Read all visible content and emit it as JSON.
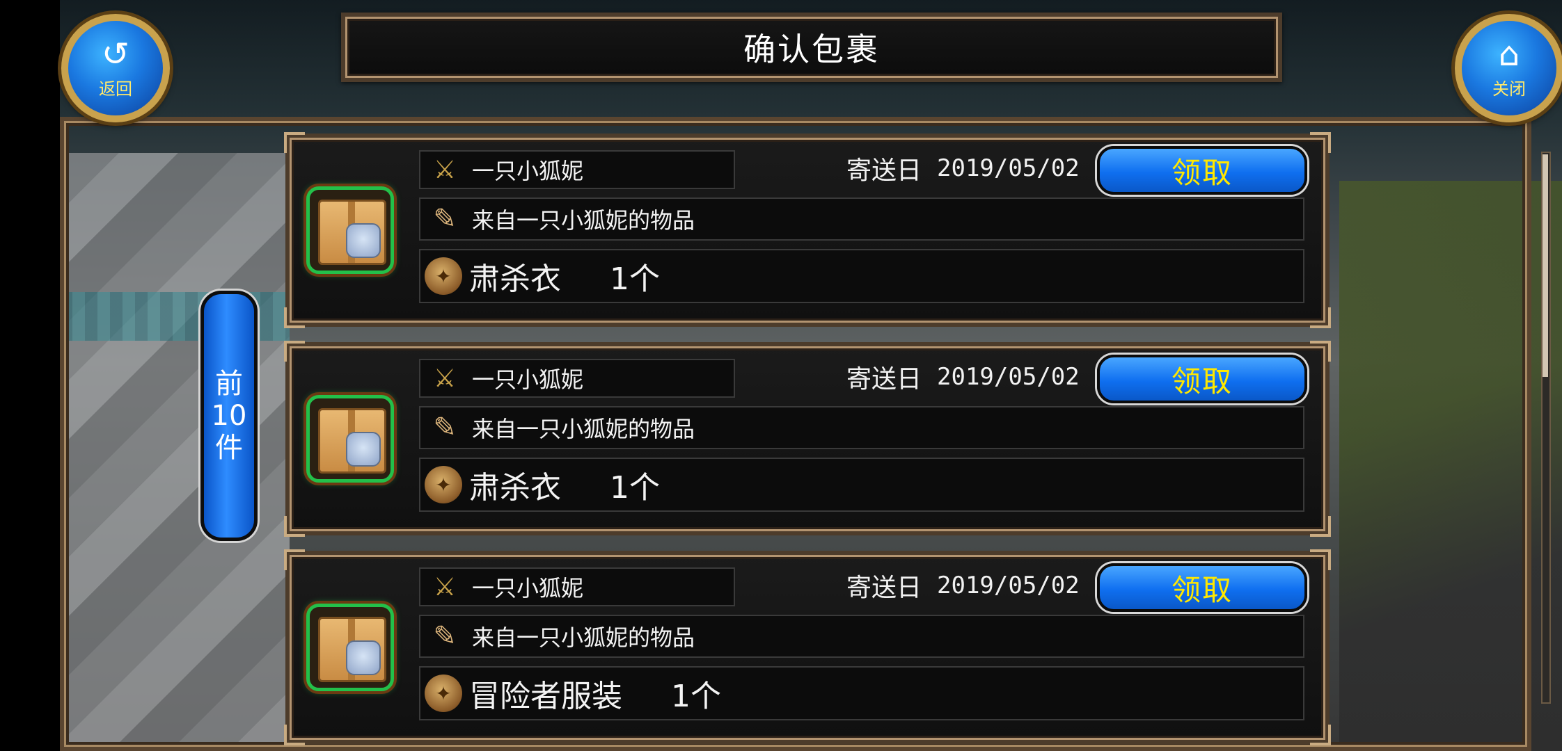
{
  "header": {
    "title": "确认包裹",
    "back_label": "返回",
    "close_label": "关闭"
  },
  "side_tab": {
    "label_line1": "前",
    "label_line2": "10",
    "label_line3": "件"
  },
  "icons": {
    "back": "back-arrow-icon",
    "close": "home-icon",
    "sender": "sword-shield-icon",
    "message": "scroll-quill-icon",
    "item": "armor-icon",
    "package": "cardboard-box-icon"
  },
  "colors": {
    "claim_button": "#1a7bf0",
    "claim_text": "#ffe800",
    "package_glow": "#23c04a",
    "frame_gold": "#b39470"
  },
  "packages": [
    {
      "sender": "一只小狐妮",
      "date_label": "寄送日",
      "date": "2019/05/02",
      "claim_label": "领取",
      "message": "来自一只小狐妮的物品",
      "item_name": "肃杀衣",
      "quantity": "1个"
    },
    {
      "sender": "一只小狐妮",
      "date_label": "寄送日",
      "date": "2019/05/02",
      "claim_label": "领取",
      "message": "来自一只小狐妮的物品",
      "item_name": "肃杀衣",
      "quantity": "1个"
    },
    {
      "sender": "一只小狐妮",
      "date_label": "寄送日",
      "date": "2019/05/02",
      "claim_label": "领取",
      "message": "来自一只小狐妮的物品",
      "item_name": "冒险者服装",
      "quantity": "1个"
    }
  ]
}
